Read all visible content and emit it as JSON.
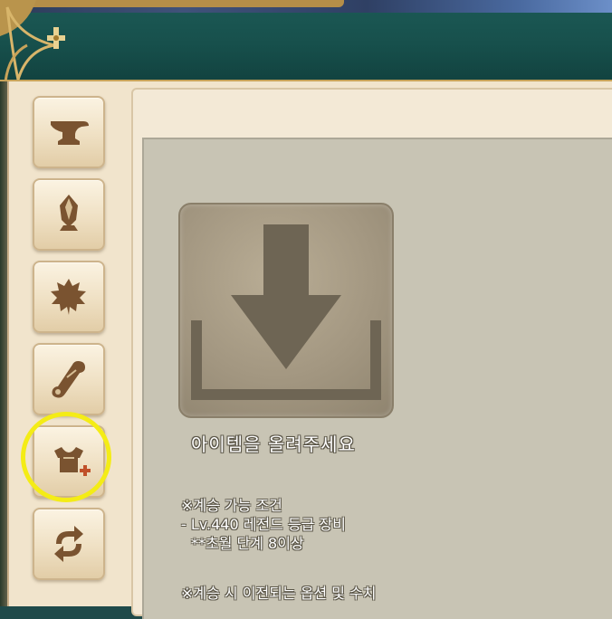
{
  "window": {
    "accent_color": "#1c5a56",
    "trim_color": "#c7a35a"
  },
  "side_menu": {
    "items": [
      {
        "icon": "anvil-icon"
      },
      {
        "icon": "crystal-icon"
      },
      {
        "icon": "leaf-icon"
      },
      {
        "icon": "scroll-icon"
      },
      {
        "icon": "armor-plus-icon",
        "selected": true
      },
      {
        "icon": "cycle-arrows-icon"
      }
    ]
  },
  "main": {
    "drop_slot_icon": "download-arrow-icon",
    "upload_prompt": "아이템을 올려주세요",
    "conditions": {
      "header": "※계승 가능 조건",
      "line1": "- Lv.440 레전드 등급 장비",
      "line2": "**초월 단계 8이상"
    },
    "transfer": {
      "header": "※계승 시 이전되는 옵션 및 수치"
    }
  }
}
